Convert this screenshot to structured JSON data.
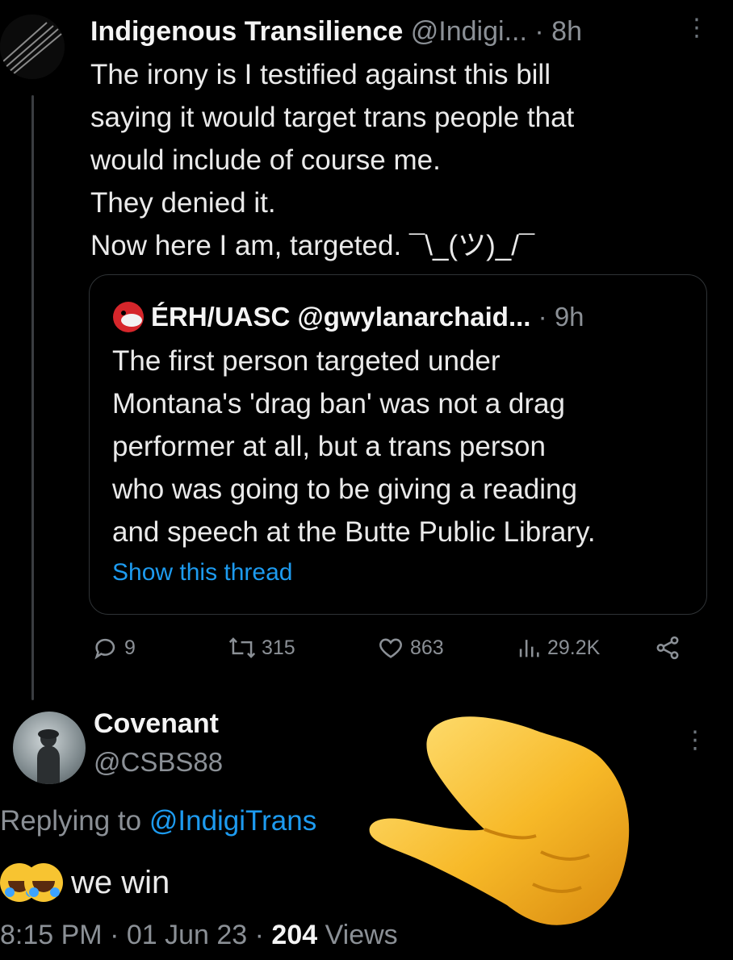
{
  "tweet": {
    "display_name": "Indigenous Transilience",
    "handle": "@Indigi...",
    "dot": "·",
    "time": "8h",
    "more_icon": "⋮",
    "lines": [
      "The irony is I testified against this bill",
      "saying it would target trans people that",
      "would include of course me.",
      "They denied it.",
      "Now here I am, targeted. ¯\\_(ツ)_/¯"
    ],
    "quote": {
      "display_name": "ÉRH/UASC",
      "handle": "@gwylanarchaid...",
      "dot": "·",
      "time": "9h",
      "lines": [
        "The first person targeted under",
        "Montana's 'drag ban' was not a drag",
        "performer at all, but a trans person",
        "who was going to be giving a reading",
        "and speech at the Butte Public Library."
      ],
      "show_thread": "Show this thread"
    },
    "actions": {
      "replies": "9",
      "retweets": "315",
      "likes": "863",
      "views": "29.2K"
    }
  },
  "reply": {
    "display_name": "Covenant",
    "handle": "@CSBS88",
    "more_icon": "⋮",
    "replying_prefix": "Replying to",
    "replying_mention": "@IndigiTrans",
    "text": "we win",
    "timestamp": "8:15 PM · 01 Jun 23 ·",
    "views_count": "204",
    "views_label": "Views"
  },
  "colors": {
    "background": "#000000",
    "link": "#1d9bf0",
    "muted": "#8b9096",
    "text": "#e7e9ea",
    "border": "#2f3336"
  },
  "icons": {
    "reply": "reply-icon",
    "retweet": "retweet-icon",
    "like": "heart-icon",
    "views": "views-icon",
    "share": "share-icon",
    "pointing_hand": "pointing-hand-emoji",
    "laughing_emoji": "face-with-tears-of-joy-emoji"
  }
}
